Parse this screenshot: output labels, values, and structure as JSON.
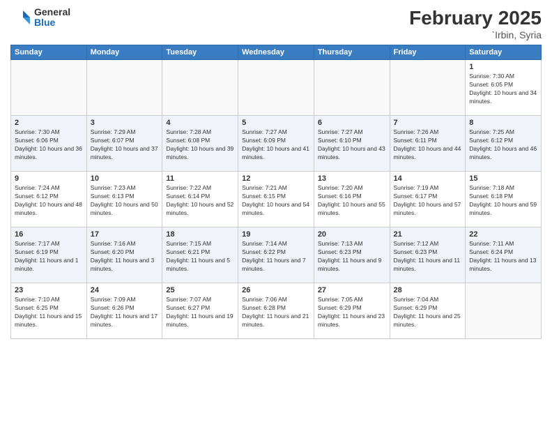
{
  "logo": {
    "general": "General",
    "blue": "Blue"
  },
  "title": {
    "month": "February 2025",
    "location": "`Irbin, Syria"
  },
  "weekdays": [
    "Sunday",
    "Monday",
    "Tuesday",
    "Wednesday",
    "Thursday",
    "Friday",
    "Saturday"
  ],
  "weeks": [
    {
      "days": [
        {
          "number": "",
          "info": ""
        },
        {
          "number": "",
          "info": ""
        },
        {
          "number": "",
          "info": ""
        },
        {
          "number": "",
          "info": ""
        },
        {
          "number": "",
          "info": ""
        },
        {
          "number": "",
          "info": ""
        },
        {
          "number": "1",
          "info": "Sunrise: 7:30 AM\nSunset: 6:05 PM\nDaylight: 10 hours and 34 minutes."
        }
      ]
    },
    {
      "days": [
        {
          "number": "2",
          "info": "Sunrise: 7:30 AM\nSunset: 6:06 PM\nDaylight: 10 hours and 36 minutes."
        },
        {
          "number": "3",
          "info": "Sunrise: 7:29 AM\nSunset: 6:07 PM\nDaylight: 10 hours and 37 minutes."
        },
        {
          "number": "4",
          "info": "Sunrise: 7:28 AM\nSunset: 6:08 PM\nDaylight: 10 hours and 39 minutes."
        },
        {
          "number": "5",
          "info": "Sunrise: 7:27 AM\nSunset: 6:09 PM\nDaylight: 10 hours and 41 minutes."
        },
        {
          "number": "6",
          "info": "Sunrise: 7:27 AM\nSunset: 6:10 PM\nDaylight: 10 hours and 43 minutes."
        },
        {
          "number": "7",
          "info": "Sunrise: 7:26 AM\nSunset: 6:11 PM\nDaylight: 10 hours and 44 minutes."
        },
        {
          "number": "8",
          "info": "Sunrise: 7:25 AM\nSunset: 6:12 PM\nDaylight: 10 hours and 46 minutes."
        }
      ]
    },
    {
      "days": [
        {
          "number": "9",
          "info": "Sunrise: 7:24 AM\nSunset: 6:12 PM\nDaylight: 10 hours and 48 minutes."
        },
        {
          "number": "10",
          "info": "Sunrise: 7:23 AM\nSunset: 6:13 PM\nDaylight: 10 hours and 50 minutes."
        },
        {
          "number": "11",
          "info": "Sunrise: 7:22 AM\nSunset: 6:14 PM\nDaylight: 10 hours and 52 minutes."
        },
        {
          "number": "12",
          "info": "Sunrise: 7:21 AM\nSunset: 6:15 PM\nDaylight: 10 hours and 54 minutes."
        },
        {
          "number": "13",
          "info": "Sunrise: 7:20 AM\nSunset: 6:16 PM\nDaylight: 10 hours and 55 minutes."
        },
        {
          "number": "14",
          "info": "Sunrise: 7:19 AM\nSunset: 6:17 PM\nDaylight: 10 hours and 57 minutes."
        },
        {
          "number": "15",
          "info": "Sunrise: 7:18 AM\nSunset: 6:18 PM\nDaylight: 10 hours and 59 minutes."
        }
      ]
    },
    {
      "days": [
        {
          "number": "16",
          "info": "Sunrise: 7:17 AM\nSunset: 6:19 PM\nDaylight: 11 hours and 1 minute."
        },
        {
          "number": "17",
          "info": "Sunrise: 7:16 AM\nSunset: 6:20 PM\nDaylight: 11 hours and 3 minutes."
        },
        {
          "number": "18",
          "info": "Sunrise: 7:15 AM\nSunset: 6:21 PM\nDaylight: 11 hours and 5 minutes."
        },
        {
          "number": "19",
          "info": "Sunrise: 7:14 AM\nSunset: 6:22 PM\nDaylight: 11 hours and 7 minutes."
        },
        {
          "number": "20",
          "info": "Sunrise: 7:13 AM\nSunset: 6:23 PM\nDaylight: 11 hours and 9 minutes."
        },
        {
          "number": "21",
          "info": "Sunrise: 7:12 AM\nSunset: 6:23 PM\nDaylight: 11 hours and 11 minutes."
        },
        {
          "number": "22",
          "info": "Sunrise: 7:11 AM\nSunset: 6:24 PM\nDaylight: 11 hours and 13 minutes."
        }
      ]
    },
    {
      "days": [
        {
          "number": "23",
          "info": "Sunrise: 7:10 AM\nSunset: 6:25 PM\nDaylight: 11 hours and 15 minutes."
        },
        {
          "number": "24",
          "info": "Sunrise: 7:09 AM\nSunset: 6:26 PM\nDaylight: 11 hours and 17 minutes."
        },
        {
          "number": "25",
          "info": "Sunrise: 7:07 AM\nSunset: 6:27 PM\nDaylight: 11 hours and 19 minutes."
        },
        {
          "number": "26",
          "info": "Sunrise: 7:06 AM\nSunset: 6:28 PM\nDaylight: 11 hours and 21 minutes."
        },
        {
          "number": "27",
          "info": "Sunrise: 7:05 AM\nSunset: 6:29 PM\nDaylight: 11 hours and 23 minutes."
        },
        {
          "number": "28",
          "info": "Sunrise: 7:04 AM\nSunset: 6:29 PM\nDaylight: 11 hours and 25 minutes."
        },
        {
          "number": "",
          "info": ""
        }
      ]
    }
  ]
}
